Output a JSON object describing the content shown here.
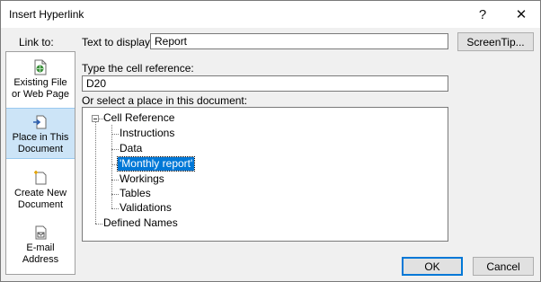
{
  "dialog": {
    "title": "Insert Hyperlink",
    "help_glyph": "?",
    "close_glyph": "✕"
  },
  "link_to": {
    "label": "Link to:",
    "items": [
      {
        "line1": "Existing File",
        "line2": "or Web Page",
        "icon": "existing-file-icon"
      },
      {
        "line1": "Place in This",
        "line2": "Document",
        "icon": "place-in-document-icon"
      },
      {
        "line1": "Create New",
        "line2": "Document",
        "icon": "new-document-icon"
      },
      {
        "line1": "E-mail",
        "line2": "Address",
        "icon": "email-icon"
      }
    ],
    "selected_index": 1
  },
  "text_to_display": {
    "label": "Text to display:",
    "value": "Report"
  },
  "screentip_label": "ScreenTip...",
  "cell_reference": {
    "label": "Type the cell reference:",
    "value": "D20"
  },
  "place_label": "Or select a place in this document:",
  "tree": {
    "root": "Cell Reference",
    "children": [
      "Instructions",
      "Data",
      "'Monthly report'",
      "Workings",
      "Tables",
      "Validations"
    ],
    "selected_child_index": 2,
    "second_root": "Defined Names"
  },
  "buttons": {
    "ok": "OK",
    "cancel": "Cancel"
  },
  "colors": {
    "selection": "#0078d7",
    "link_selected_bg": "#cce4f7"
  }
}
